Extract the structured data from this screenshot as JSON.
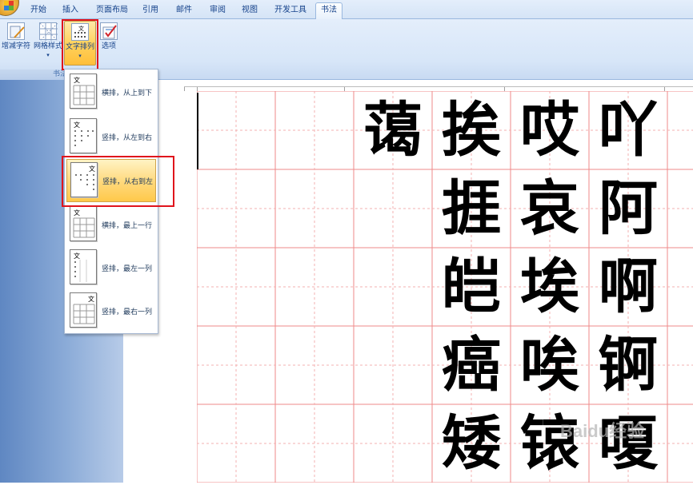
{
  "tabs": [
    "开始",
    "插入",
    "页面布局",
    "引用",
    "邮件",
    "审阅",
    "视图",
    "开发工具",
    "书法"
  ],
  "active_tab": "书法",
  "ribbon": {
    "buttons": [
      {
        "label": "增减字符"
      },
      {
        "label": "网格样式"
      },
      {
        "label": "文字排列"
      },
      {
        "label": "选项"
      }
    ],
    "group_label": "书法"
  },
  "dropdown": {
    "items": [
      {
        "label": "横排，从上到下",
        "thumb_glyph": "文"
      },
      {
        "label": "竖排，从左到右",
        "thumb_glyph": "文"
      },
      {
        "label": "竖排，从右到左",
        "thumb_glyph": "文"
      },
      {
        "label": "横排，最上一行",
        "thumb_glyph": "文"
      },
      {
        "label": "竖排，最左一列",
        "thumb_glyph": "文"
      },
      {
        "label": "竖排，最右一列",
        "thumb_glyph": "文"
      }
    ],
    "selected_index": 2
  },
  "document": {
    "columns": [
      [
        "吖",
        "阿",
        "啊",
        "锕",
        "嗄"
      ],
      [
        "哎",
        "哀",
        "埃",
        "唉",
        "锿"
      ],
      [
        "挨",
        "捱",
        "皑",
        "癌",
        "矮"
      ],
      [
        "蔼"
      ]
    ]
  },
  "watermark": "Baidu经验",
  "colors": {
    "grid_line": "#ef8a8a",
    "highlight": "#ffd25e",
    "annotation": "#e0141c"
  }
}
